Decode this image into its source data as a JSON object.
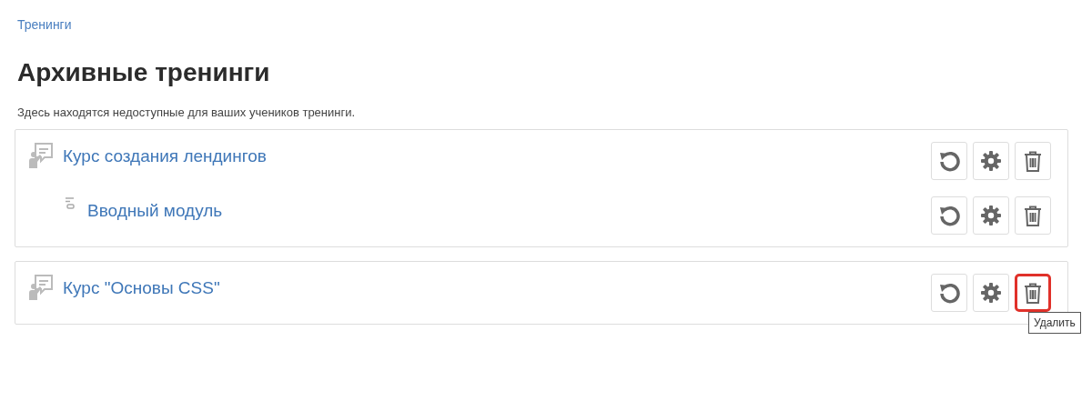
{
  "breadcrumb": "Тренинги",
  "title": "Архивные тренинги",
  "description": "Здесь находятся недоступные для ваших учеников тренинги.",
  "trainings": [
    {
      "kind": "course",
      "title": "Курс создания лендингов",
      "actions": [
        {
          "kind": "restore",
          "hovered": false
        },
        {
          "kind": "settings",
          "hovered": false
        },
        {
          "kind": "delete",
          "hovered": false
        }
      ],
      "children": [
        {
          "kind": "module",
          "title": "Вводный модуль",
          "actions": [
            {
              "kind": "restore",
              "hovered": false
            },
            {
              "kind": "settings",
              "hovered": false
            },
            {
              "kind": "delete",
              "hovered": false
            }
          ]
        }
      ]
    },
    {
      "kind": "course",
      "title": "Курс \"Основы CSS\"",
      "actions": [
        {
          "kind": "restore",
          "hovered": false
        },
        {
          "kind": "settings",
          "hovered": false
        },
        {
          "kind": "delete",
          "hovered": true
        }
      ]
    }
  ],
  "tooltip": "Удалить"
}
